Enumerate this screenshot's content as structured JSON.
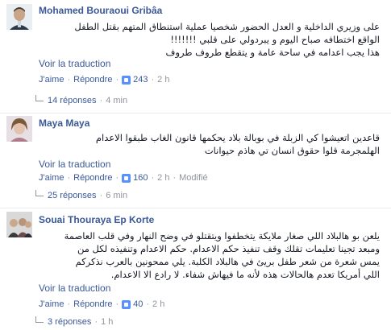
{
  "comments": [
    {
      "author": "Mohamed Bouraoui Gribâa",
      "lines": [
        "على وزيري الداخلية و العدل الحضور شخصيا عملية استنطاق المتهم بقتل الطفل",
        "الواقع اختطافه صباح اليوم و يبردولي على قلبي !!!!!!!",
        "هذا يجب اعدامه في ساحة عامة و يتقطع طروف طروف"
      ],
      "translate": "Voir la traduction",
      "like": "J'aime",
      "reply": "Répondre",
      "likes": "243",
      "time": "2 h",
      "edited": "",
      "replies_label": "14 réponses",
      "replies_time": "4 min"
    },
    {
      "author": "Maya Maya",
      "lines": [
        "قاعدين اتعيشوا كي الزبلة في بوبالة بلاد يحكمها قانون الغاب طبقوا الاعدام",
        "الهلمجرمة قلوا حقوق انسان تي هاذم حيوانات"
      ],
      "translate": "Voir la traduction",
      "like": "J'aime",
      "reply": "Répondre",
      "likes": "160",
      "time": "2 h",
      "edited": "Modifié",
      "replies_label": "25 réponses",
      "replies_time": "6 min"
    },
    {
      "author": "Souai Thouraya Ep Korte",
      "lines": [
        "يلعن بو هالبلاد اللي صغار ملايكة يتخطفوا ويتقتلو في وضح النهار وفي قلب العاصمة",
        "ومبعد تجينا تعليمات تقلك وقف تنفيذ حكم الاعدام. حكم الاعدام وتنفيذه لكل من",
        "يمس شعرة من شعر طفل بريئ في هالبلاد الكلبة. يلي ممحونين بالعرب نذكركم",
        "اللي أمريكا تعدم هالحالات هذه لأنه ما فيهاش شفاء. لا رادع الا الاعدام."
      ],
      "translate": "Voir la traduction",
      "like": "J'aime",
      "reply": "Répondre",
      "likes": "40",
      "time": "2 h",
      "edited": "",
      "replies_label": "3 réponses",
      "replies_time": "1 h"
    }
  ],
  "colors": {
    "link": "#3b5998",
    "muted": "#90949c",
    "like": "#5890ff"
  }
}
